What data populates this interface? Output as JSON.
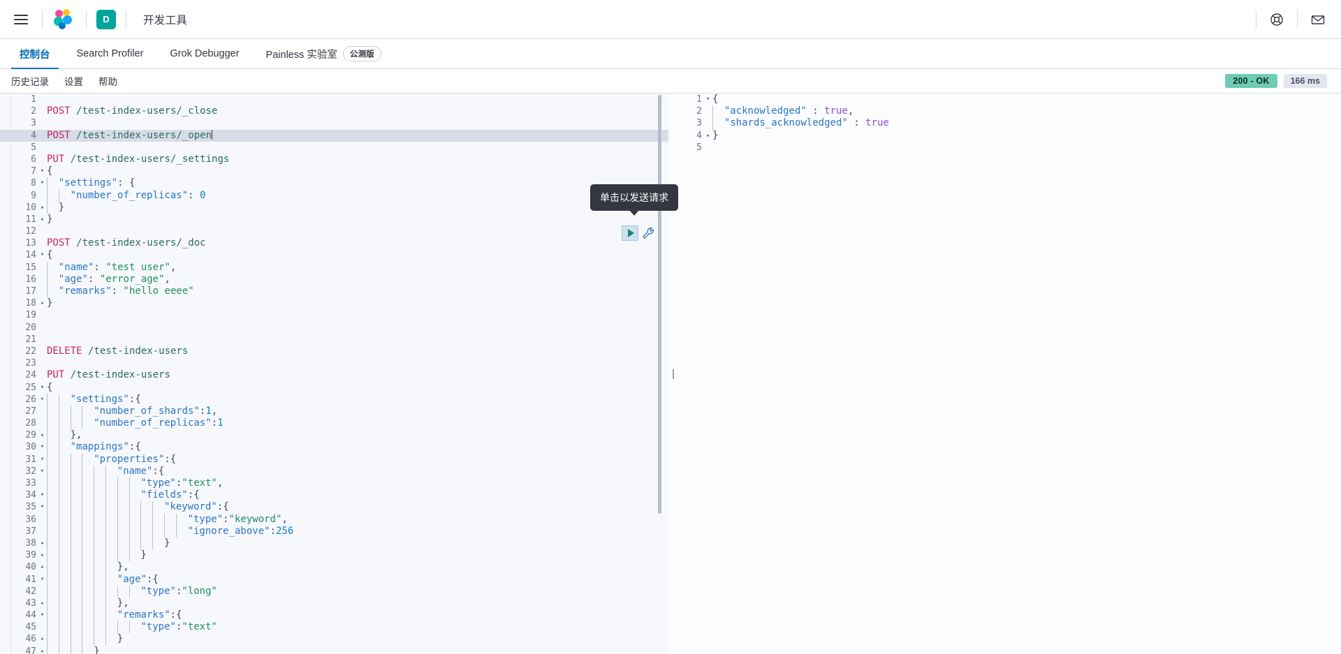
{
  "chrome": {
    "menu_icon": "hamburger-icon",
    "logo_icon": "elastic-logo-icon",
    "space_badge": "D",
    "app_title": "开发工具",
    "help_icon": "help-lifebuoy-icon",
    "mail_icon": "envelope-icon"
  },
  "tabs": [
    {
      "label": "控制台",
      "active": true,
      "badge": ""
    },
    {
      "label": "Search Profiler",
      "active": false,
      "badge": ""
    },
    {
      "label": "Grok Debugger",
      "active": false,
      "badge": ""
    },
    {
      "label": "Painless 实验室",
      "active": false,
      "badge": "公测版"
    }
  ],
  "subbar": {
    "links": [
      "历史记录",
      "设置",
      "帮助"
    ],
    "status_code": "200 - OK",
    "duration": "166 ms",
    "status_color": "#6dccb1"
  },
  "tooltip": {
    "text": "单击以发送请求"
  },
  "actions": {
    "play_icon": "play-request-icon",
    "wrench_icon": "wrench-settings-icon"
  },
  "request_editor": {
    "cursor_line": 4,
    "lines": [
      {
        "n": 1,
        "fold": "",
        "text": ""
      },
      {
        "n": 2,
        "fold": "",
        "text": "POST /test-index-users/_close"
      },
      {
        "n": 3,
        "fold": "",
        "text": ""
      },
      {
        "n": 4,
        "fold": "",
        "text": "POST /test-index-users/_open"
      },
      {
        "n": 5,
        "fold": "",
        "text": ""
      },
      {
        "n": 6,
        "fold": "",
        "text": "PUT /test-index-users/_settings"
      },
      {
        "n": 7,
        "fold": "▾",
        "text": "{"
      },
      {
        "n": 8,
        "fold": "▾",
        "text": "  \"settings\": {"
      },
      {
        "n": 9,
        "fold": "",
        "text": "    \"number_of_replicas\": 0"
      },
      {
        "n": 10,
        "fold": "▴",
        "text": "  }"
      },
      {
        "n": 11,
        "fold": "▴",
        "text": "}"
      },
      {
        "n": 12,
        "fold": "",
        "text": ""
      },
      {
        "n": 13,
        "fold": "",
        "text": "POST /test-index-users/_doc"
      },
      {
        "n": 14,
        "fold": "▾",
        "text": "{"
      },
      {
        "n": 15,
        "fold": "",
        "text": "  \"name\": \"test user\","
      },
      {
        "n": 16,
        "fold": "",
        "text": "  \"age\": \"error_age\","
      },
      {
        "n": 17,
        "fold": "",
        "text": "  \"remarks\": \"hello eeee\""
      },
      {
        "n": 18,
        "fold": "▴",
        "text": "}"
      },
      {
        "n": 19,
        "fold": "",
        "text": ""
      },
      {
        "n": 20,
        "fold": "",
        "text": ""
      },
      {
        "n": 21,
        "fold": "",
        "text": ""
      },
      {
        "n": 22,
        "fold": "",
        "text": "DELETE /test-index-users"
      },
      {
        "n": 23,
        "fold": "",
        "text": ""
      },
      {
        "n": 24,
        "fold": "",
        "text": "PUT /test-index-users"
      },
      {
        "n": 25,
        "fold": "▾",
        "text": "{"
      },
      {
        "n": 26,
        "fold": "▾",
        "text": "    \"settings\":{"
      },
      {
        "n": 27,
        "fold": "",
        "text": "        \"number_of_shards\":1,"
      },
      {
        "n": 28,
        "fold": "",
        "text": "        \"number_of_replicas\":1"
      },
      {
        "n": 29,
        "fold": "▴",
        "text": "    },"
      },
      {
        "n": 30,
        "fold": "▾",
        "text": "    \"mappings\":{"
      },
      {
        "n": 31,
        "fold": "▾",
        "text": "        \"properties\":{"
      },
      {
        "n": 32,
        "fold": "▾",
        "text": "            \"name\":{"
      },
      {
        "n": 33,
        "fold": "",
        "text": "                \"type\":\"text\","
      },
      {
        "n": 34,
        "fold": "▾",
        "text": "                \"fields\":{"
      },
      {
        "n": 35,
        "fold": "▾",
        "text": "                    \"keyword\":{"
      },
      {
        "n": 36,
        "fold": "",
        "text": "                        \"type\":\"keyword\","
      },
      {
        "n": 37,
        "fold": "",
        "text": "                        \"ignore_above\":256"
      },
      {
        "n": 38,
        "fold": "▴",
        "text": "                    }"
      },
      {
        "n": 39,
        "fold": "▴",
        "text": "                }"
      },
      {
        "n": 40,
        "fold": "▴",
        "text": "            },"
      },
      {
        "n": 41,
        "fold": "▾",
        "text": "            \"age\":{"
      },
      {
        "n": 42,
        "fold": "",
        "text": "                \"type\":\"long\""
      },
      {
        "n": 43,
        "fold": "▴",
        "text": "            },"
      },
      {
        "n": 44,
        "fold": "▾",
        "text": "            \"remarks\":{"
      },
      {
        "n": 45,
        "fold": "",
        "text": "                \"type\":\"text\""
      },
      {
        "n": 46,
        "fold": "▴",
        "text": "            }"
      },
      {
        "n": 47,
        "fold": "▴",
        "text": "        }"
      }
    ]
  },
  "response_editor": {
    "lines": [
      {
        "n": 1,
        "fold": "▾",
        "text": "{"
      },
      {
        "n": 2,
        "fold": "",
        "text": "  \"acknowledged\" : true,"
      },
      {
        "n": 3,
        "fold": "",
        "text": "  \"shards_acknowledged\" : true"
      },
      {
        "n": 4,
        "fold": "▴",
        "text": "}"
      },
      {
        "n": 5,
        "fold": "",
        "text": ""
      }
    ]
  }
}
